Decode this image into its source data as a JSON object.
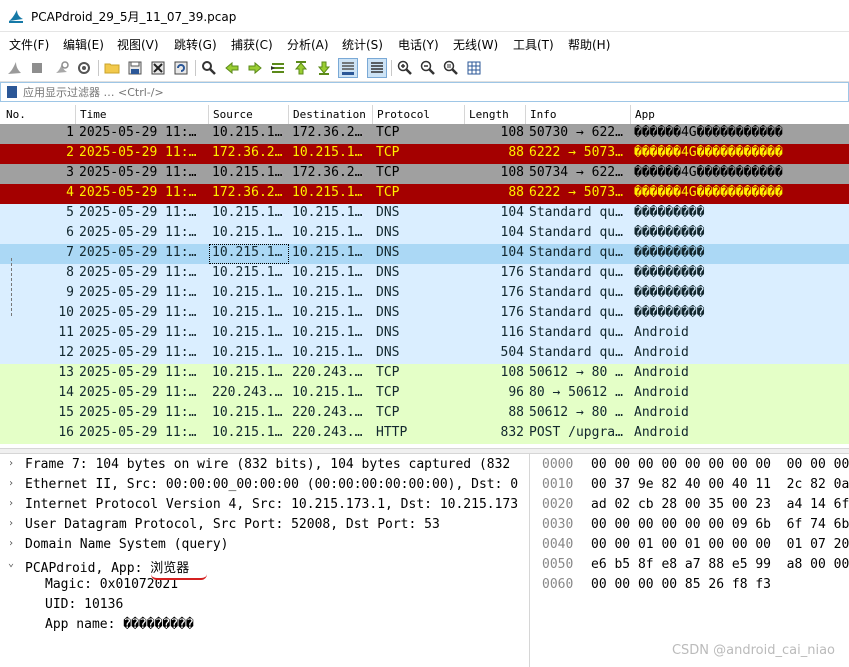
{
  "window": {
    "title": "PCAPdroid_29_5月_11_07_39.pcap"
  },
  "menu": [
    "文件(F)",
    "编辑(E)",
    "视图(V)",
    "跳转(G)",
    "捕获(C)",
    "分析(A)",
    "统计(S)",
    "电话(Y)",
    "无线(W)",
    "工具(T)",
    "帮助(H)"
  ],
  "toolbar": {
    "icons": [
      "shark-fin-start-icon",
      "stop-icon",
      "restart-icon",
      "options-gear-icon",
      "open-folder-icon",
      "save-icon",
      "close-file-icon",
      "reload-icon",
      "find-icon",
      "go-back-icon",
      "go-forward-icon",
      "go-to-packet-icon",
      "go-first-icon",
      "go-last-icon",
      "autoscroll-icon",
      "colorize-icon",
      "zoom-in-icon",
      "zoom-out-icon",
      "zoom-normal-icon",
      "resize-columns-icon"
    ]
  },
  "filter": {
    "placeholder": "应用显示过滤器 … <Ctrl-/>"
  },
  "columns": [
    "No.",
    "Time",
    "Source",
    "Destination",
    "Protocol",
    "Length",
    "Info",
    "App"
  ],
  "packets": [
    {
      "no": "1",
      "time": "2025-05-29 11:…",
      "src": "10.215.1…",
      "dst": "172.36.2…",
      "proto": "TCP",
      "len": "108",
      "info": "50730 → 622…",
      "app": "������4G�����������",
      "style": "gray"
    },
    {
      "no": "2",
      "time": "2025-05-29 11:…",
      "src": "172.36.2…",
      "dst": "10.215.1…",
      "proto": "TCP",
      "len": "88",
      "info": "6222 → 5073…",
      "app": "������4G�����������",
      "style": "red"
    },
    {
      "no": "3",
      "time": "2025-05-29 11:…",
      "src": "10.215.1…",
      "dst": "172.36.2…",
      "proto": "TCP",
      "len": "108",
      "info": "50734 → 622…",
      "app": "������4G�����������",
      "style": "gray"
    },
    {
      "no": "4",
      "time": "2025-05-29 11:…",
      "src": "172.36.2…",
      "dst": "10.215.1…",
      "proto": "TCP",
      "len": "88",
      "info": "6222 → 5073…",
      "app": "������4G�����������",
      "style": "red"
    },
    {
      "no": "5",
      "time": "2025-05-29 11:…",
      "src": "10.215.1…",
      "dst": "10.215.1…",
      "proto": "DNS",
      "len": "104",
      "info": "Standard qu…",
      "app": "���������",
      "style": "blue"
    },
    {
      "no": "6",
      "time": "2025-05-29 11:…",
      "src": "10.215.1…",
      "dst": "10.215.1…",
      "proto": "DNS",
      "len": "104",
      "info": "Standard qu…",
      "app": "���������",
      "style": "blue"
    },
    {
      "no": "7",
      "time": "2025-05-29 11:…",
      "src": "10.215.1…",
      "dst": "10.215.1…",
      "proto": "DNS",
      "len": "104",
      "info": "Standard qu…",
      "app": "���������",
      "style": "sel"
    },
    {
      "no": "8",
      "time": "2025-05-29 11:…",
      "src": "10.215.1…",
      "dst": "10.215.1…",
      "proto": "DNS",
      "len": "176",
      "info": "Standard qu…",
      "app": "���������",
      "style": "blue"
    },
    {
      "no": "9",
      "time": "2025-05-29 11:…",
      "src": "10.215.1…",
      "dst": "10.215.1…",
      "proto": "DNS",
      "len": "176",
      "info": "Standard qu…",
      "app": "���������",
      "style": "blue"
    },
    {
      "no": "10",
      "time": "2025-05-29 11:…",
      "src": "10.215.1…",
      "dst": "10.215.1…",
      "proto": "DNS",
      "len": "176",
      "info": "Standard qu…",
      "app": "���������",
      "style": "blue"
    },
    {
      "no": "11",
      "time": "2025-05-29 11:…",
      "src": "10.215.1…",
      "dst": "10.215.1…",
      "proto": "DNS",
      "len": "116",
      "info": "Standard qu…",
      "app": "Android",
      "style": "blue"
    },
    {
      "no": "12",
      "time": "2025-05-29 11:…",
      "src": "10.215.1…",
      "dst": "10.215.1…",
      "proto": "DNS",
      "len": "504",
      "info": "Standard qu…",
      "app": "Android",
      "style": "blue"
    },
    {
      "no": "13",
      "time": "2025-05-29 11:…",
      "src": "10.215.1…",
      "dst": "220.243.…",
      "proto": "TCP",
      "len": "108",
      "info": "50612 → 80 …",
      "app": "Android",
      "style": "green"
    },
    {
      "no": "14",
      "time": "2025-05-29 11:…",
      "src": "220.243.…",
      "dst": "10.215.1…",
      "proto": "TCP",
      "len": "96",
      "info": "80 → 50612 …",
      "app": "Android",
      "style": "green"
    },
    {
      "no": "15",
      "time": "2025-05-29 11:…",
      "src": "10.215.1…",
      "dst": "220.243.…",
      "proto": "TCP",
      "len": "88",
      "info": "50612 → 80 …",
      "app": "Android",
      "style": "green"
    },
    {
      "no": "16",
      "time": "2025-05-29 11:…",
      "src": "10.215.1…",
      "dst": "220.243.…",
      "proto": "HTTP",
      "len": "832",
      "info": "POST /upgra…",
      "app": "Android",
      "style": "green"
    }
  ],
  "details": [
    {
      "arrow": "›",
      "text": "Frame 7: 104 bytes on wire (832 bits), 104 bytes captured (832",
      "child": false
    },
    {
      "arrow": "›",
      "text": "Ethernet II, Src: 00:00:00_00:00:00 (00:00:00:00:00:00), Dst: 0",
      "child": false
    },
    {
      "arrow": "›",
      "text": "Internet Protocol Version 4, Src: 10.215.173.1, Dst: 10.215.173",
      "child": false
    },
    {
      "arrow": "›",
      "text": "User Datagram Protocol, Src Port: 52008, Dst Port: 53",
      "child": false
    },
    {
      "arrow": "›",
      "text": "Domain Name System (query)",
      "child": false
    },
    {
      "arrow": "⌄",
      "text": "PCAPdroid, App: 浏览器",
      "child": false
    },
    {
      "arrow": "",
      "text": "Magic: 0x01072021",
      "child": true
    },
    {
      "arrow": "",
      "text": "UID: 10136",
      "child": true
    },
    {
      "arrow": "",
      "text": "App name: ���������",
      "child": true
    }
  ],
  "bytes": [
    {
      "off": "0000",
      "hex": "00 00 00 00 00 00 00 00  00 00 00"
    },
    {
      "off": "0010",
      "hex": "00 37 9e 82 40 00 40 11  2c 82 0a"
    },
    {
      "off": "0020",
      "hex": "ad 02 cb 28 00 35 00 23  a4 14 6f"
    },
    {
      "off": "0030",
      "hex": "00 00 00 00 00 00 09 6b  6f 74 6b"
    },
    {
      "off": "0040",
      "hex": "00 00 01 00 01 00 00 00  01 07 20"
    },
    {
      "off": "0050",
      "hex": "e6 b5 8f e8 a7 88 e5 99  a8 00 00"
    },
    {
      "off": "0060",
      "hex": "00 00 00 00 85 26 f8 f3"
    }
  ],
  "watermark": "CSDN @android_cai_niao",
  "colors": {
    "gray": "#a0a0a0",
    "red": "#a40000",
    "red_text": "#fff000",
    "blue": "#daeeff",
    "selected": "#abd8f5",
    "green": "#e4ffc7"
  }
}
